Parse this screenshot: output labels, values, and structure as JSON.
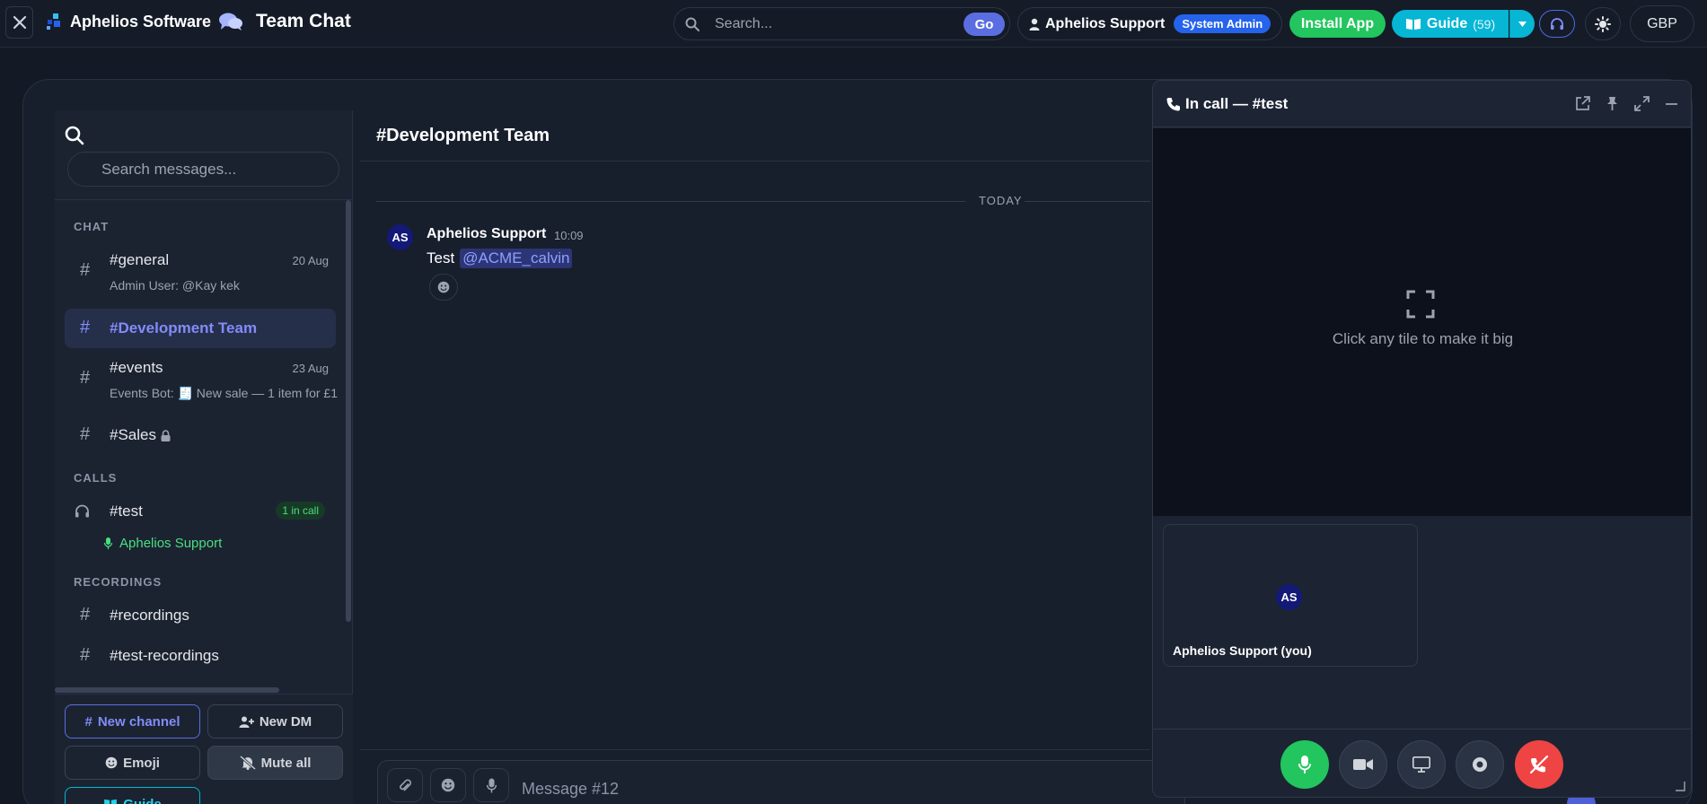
{
  "topbar": {
    "company": "Aphelios Software",
    "app_name": "Team Chat",
    "search_placeholder": "Search...",
    "go_label": "Go",
    "user_name": "Aphelios Support",
    "user_role": "System Admin",
    "install_label": "Install App",
    "guide_label": "Guide",
    "guide_count": "(59)",
    "currency": "GBP"
  },
  "sidebar": {
    "search_placeholder": "Search messages...",
    "sections": {
      "chat": "CHAT",
      "calls": "CALLS",
      "recordings": "RECORDINGS"
    },
    "channels": [
      {
        "name": "#general",
        "date": "20 Aug",
        "preview": "Admin User: @Kay kek"
      },
      {
        "name": "#Development Team",
        "date": "",
        "preview": ""
      },
      {
        "name": "#events",
        "date": "23 Aug",
        "preview": "Events Bot: 🧾 New sale — 1 item for £1"
      },
      {
        "name": "#Sales",
        "date": "",
        "preview": ""
      }
    ],
    "calls": [
      {
        "name": "#test",
        "badge": "1 in call",
        "participant": "Aphelios Support"
      }
    ],
    "recordings": [
      {
        "name": "#recordings"
      },
      {
        "name": "#test-recordings"
      }
    ],
    "footer": {
      "new_channel": "New channel",
      "new_dm": "New DM",
      "emoji": "Emoji",
      "mute_all": "Mute all",
      "guide": "Guide"
    }
  },
  "chat": {
    "title": "#Development Team",
    "day_label": "TODAY",
    "messages": [
      {
        "avatar": "AS",
        "author": "Aphelios Support",
        "time": "10:09",
        "text": "Test",
        "mention": "@ACME_calvin"
      }
    ],
    "composer_placeholder": "Message #12"
  },
  "call_panel": {
    "title": "In call — #test",
    "stage_hint": "Click any tile to make it big",
    "tiles": [
      {
        "avatar": "AS",
        "name": "Aphelios Support (you)"
      }
    ]
  },
  "colors": {
    "accent": "#5b6ee1",
    "success": "#22c55e",
    "danger": "#ef4444",
    "info": "#06b6d4",
    "background": "#131a25"
  }
}
